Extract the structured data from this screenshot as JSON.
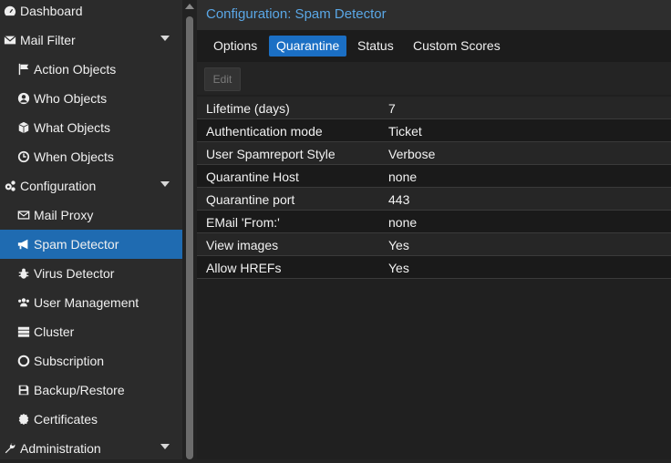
{
  "sidebar": {
    "items": [
      {
        "label": "Dashboard",
        "icon": "dashboard-icon"
      },
      {
        "label": "Mail Filter",
        "icon": "envelope-icon"
      },
      {
        "label": "Action Objects",
        "icon": "flag-icon"
      },
      {
        "label": "Who Objects",
        "icon": "user-circle-icon"
      },
      {
        "label": "What Objects",
        "icon": "cube-icon"
      },
      {
        "label": "When Objects",
        "icon": "clock-icon"
      },
      {
        "label": "Configuration",
        "icon": "gears-icon"
      },
      {
        "label": "Mail Proxy",
        "icon": "envelope-outline-icon"
      },
      {
        "label": "Spam Detector",
        "icon": "bullhorn-icon"
      },
      {
        "label": "Virus Detector",
        "icon": "bug-icon"
      },
      {
        "label": "User Management",
        "icon": "users-icon"
      },
      {
        "label": "Cluster",
        "icon": "server-icon"
      },
      {
        "label": "Subscription",
        "icon": "life-ring-icon"
      },
      {
        "label": "Backup/Restore",
        "icon": "floppy-icon"
      },
      {
        "label": "Certificates",
        "icon": "certificate-icon"
      },
      {
        "label": "Administration",
        "icon": "wrench-icon"
      }
    ]
  },
  "main": {
    "title": "Configuration: Spam Detector",
    "tabs": [
      "Options",
      "Quarantine",
      "Status",
      "Custom Scores"
    ],
    "active_tab": "Quarantine",
    "toolbar": {
      "edit_label": "Edit"
    },
    "rows": [
      {
        "name": "Lifetime (days)",
        "value": "7"
      },
      {
        "name": "Authentication mode",
        "value": "Ticket"
      },
      {
        "name": "User Spamreport Style",
        "value": "Verbose"
      },
      {
        "name": "Quarantine Host",
        "value": "none"
      },
      {
        "name": "Quarantine port",
        "value": "443"
      },
      {
        "name": "EMail 'From:'",
        "value": "none"
      },
      {
        "name": "View images",
        "value": "Yes"
      },
      {
        "name": "Allow HREFs",
        "value": "Yes"
      }
    ]
  },
  "colors": {
    "accent": "#1f6bb1",
    "title": "#5aa7e6"
  }
}
